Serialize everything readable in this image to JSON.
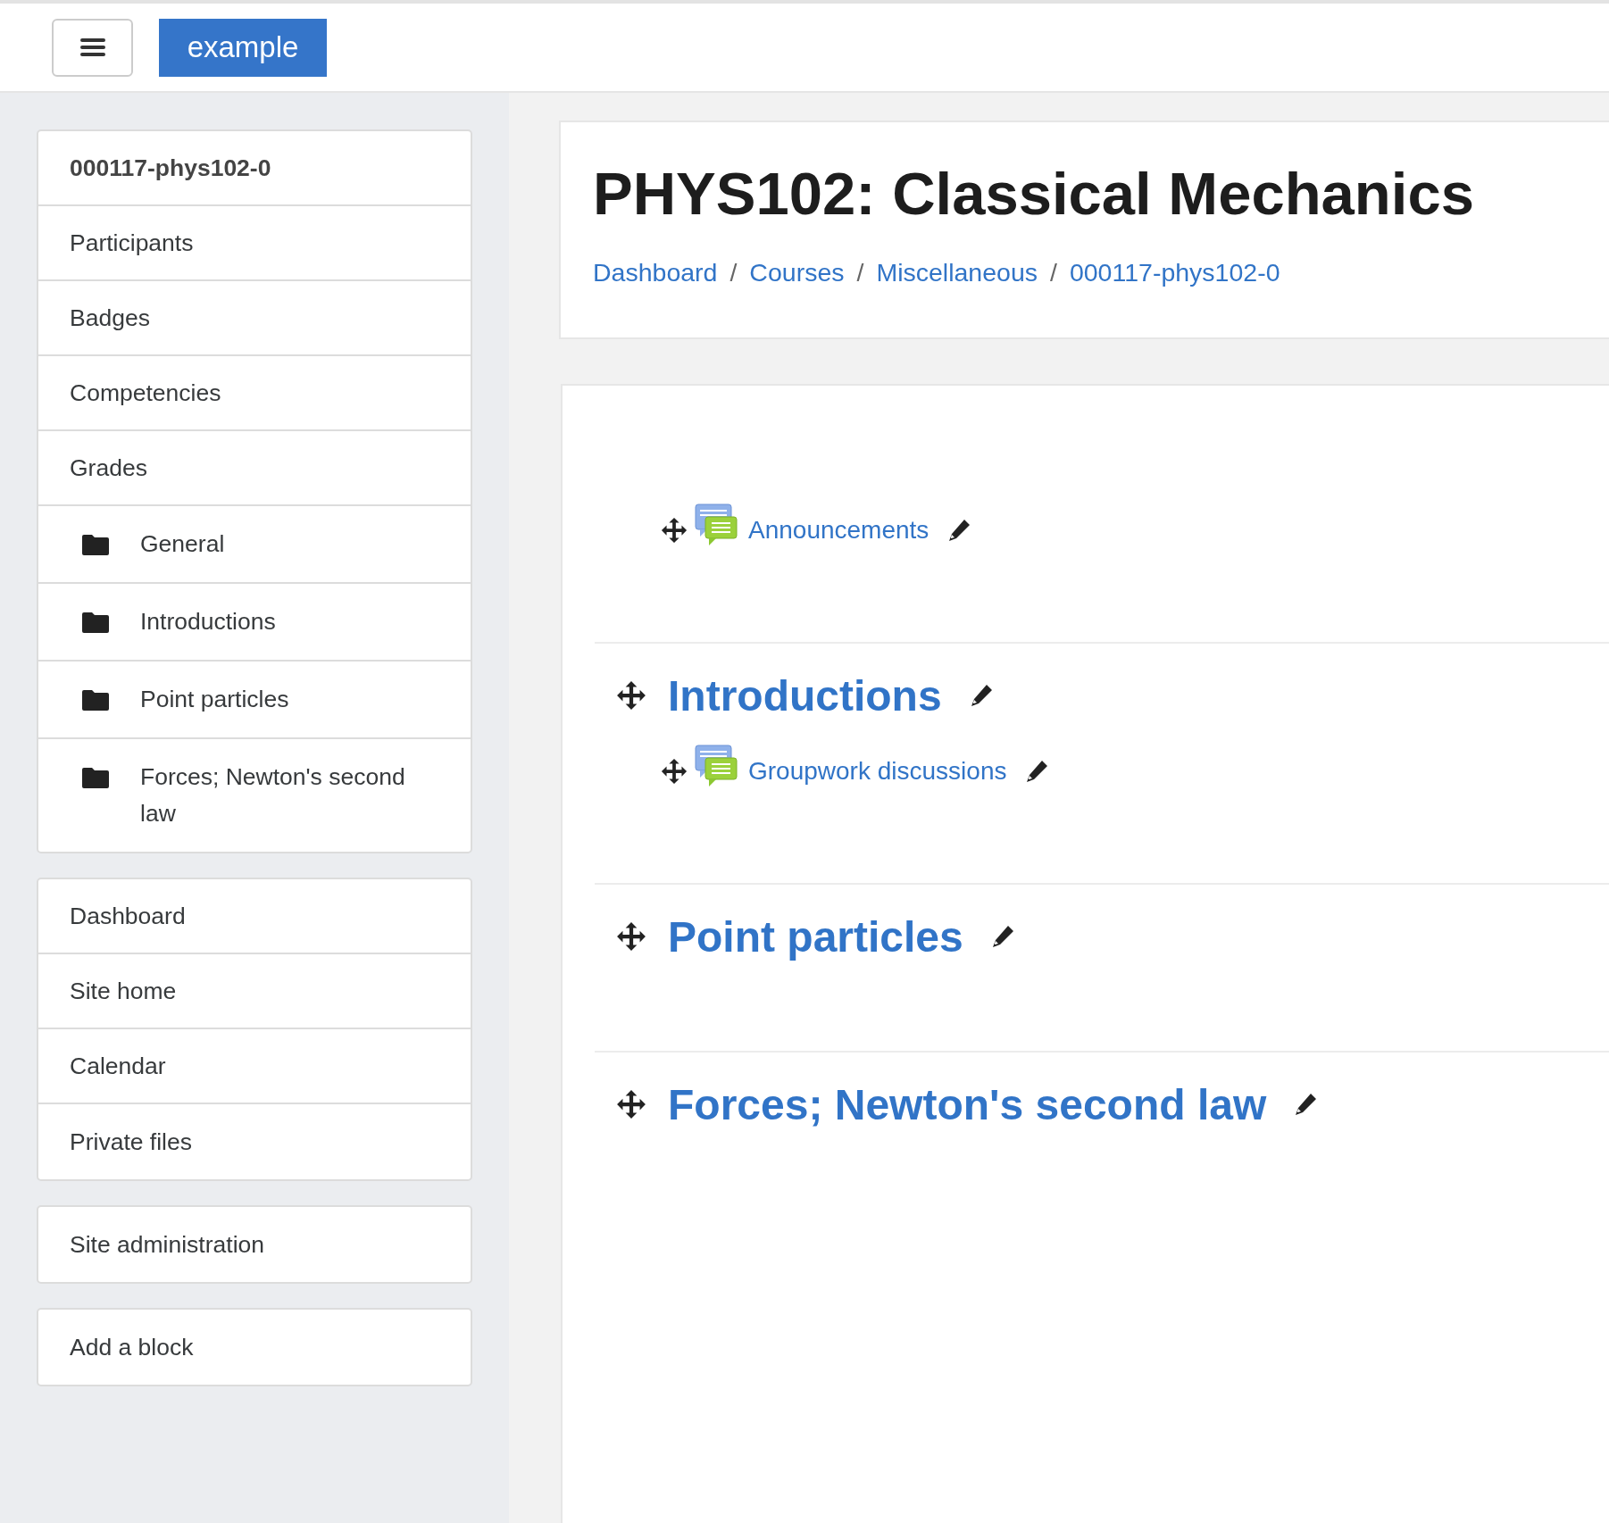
{
  "header": {
    "brand": "example"
  },
  "course_nav": {
    "title": "000117-phys102-0",
    "items": [
      {
        "label": "Participants",
        "kind": "link"
      },
      {
        "label": "Badges",
        "kind": "link"
      },
      {
        "label": "Competencies",
        "kind": "link"
      },
      {
        "label": "Grades",
        "kind": "link"
      },
      {
        "label": "General",
        "kind": "section"
      },
      {
        "label": "Introductions",
        "kind": "section"
      },
      {
        "label": "Point particles",
        "kind": "section"
      },
      {
        "label": "Forces; Newton's second law",
        "kind": "section"
      }
    ]
  },
  "site_nav": {
    "items": [
      {
        "label": "Dashboard",
        "kind": "link"
      },
      {
        "label": "Site home",
        "kind": "link"
      },
      {
        "label": "Calendar",
        "kind": "link"
      },
      {
        "label": "Private files",
        "kind": "link"
      }
    ]
  },
  "admin_nav": {
    "items": [
      {
        "label": "Site administration",
        "kind": "link"
      }
    ]
  },
  "add_block": {
    "items": [
      {
        "label": "Add a block",
        "kind": "link"
      }
    ]
  },
  "page": {
    "title": "PHYS102: Classical Mechanics",
    "breadcrumb": [
      "Dashboard",
      "Courses",
      "Miscellaneous",
      "000117-phys102-0"
    ],
    "breadcrumb_separator": "/"
  },
  "sections": [
    {
      "activities": [
        {
          "label": "Announcements",
          "kind": "forum"
        }
      ]
    },
    {
      "title": "Introductions",
      "activities": [
        {
          "label": "Groupwork discussions",
          "kind": "forum"
        }
      ]
    },
    {
      "title": "Point particles"
    },
    {
      "title": "Forces; Newton's second law"
    }
  ]
}
